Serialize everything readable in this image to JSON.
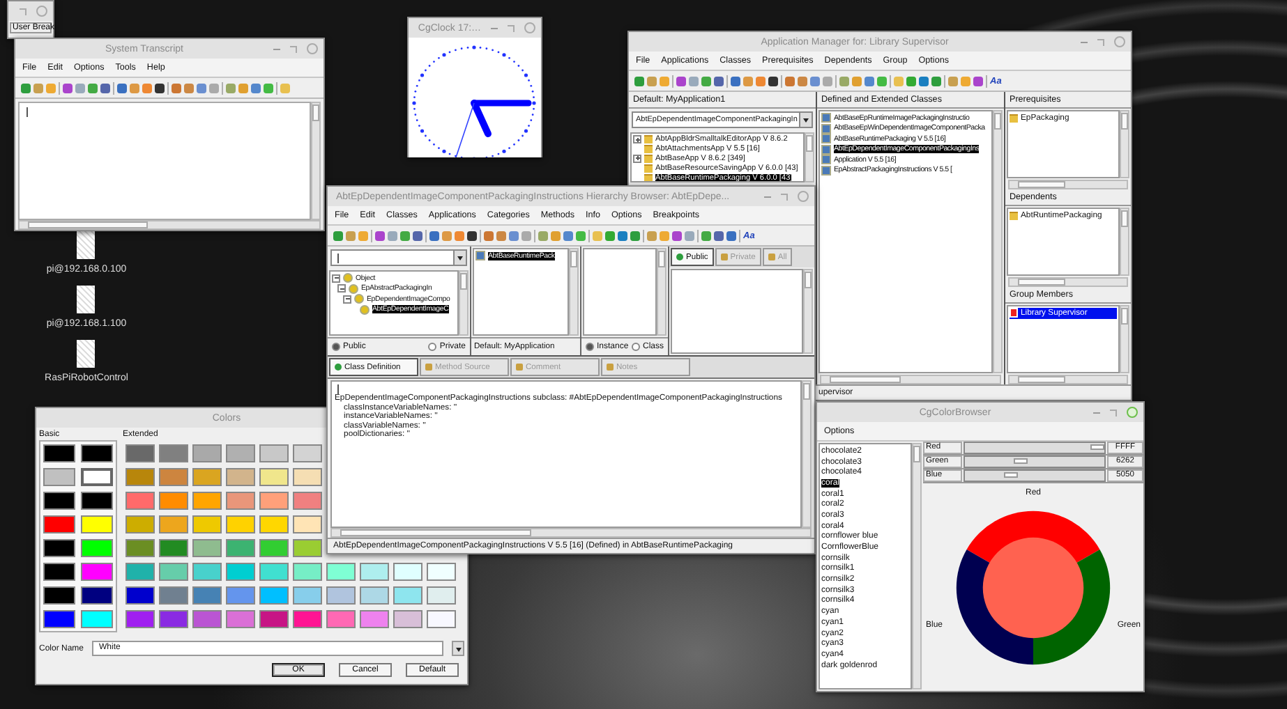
{
  "user_break": {
    "button": "User Break"
  },
  "desktop_icons": [
    {
      "label": "pi@192.168.0.100"
    },
    {
      "label": "pi@192.168.1.100"
    },
    {
      "label": "RasPiRobotControl"
    }
  ],
  "transcript": {
    "title": "System Transcript",
    "menu": [
      "File",
      "Edit",
      "Options",
      "Tools",
      "Help"
    ]
  },
  "clock": {
    "title": "CgClock 17:…"
  },
  "app_manager": {
    "title": "Application Manager for: Library Supervisor",
    "menu": [
      "File",
      "Applications",
      "Classes",
      "Prerequisites",
      "Dependents",
      "Group",
      "Options"
    ],
    "font_button": "Aa",
    "default_label": "Default: MyApplication1",
    "application_field": "AbtEpDependentImageComponentPackagingIn",
    "applications": [
      {
        "label": "AbtAppBldrSmalltalkEditorApp V 8.6.2",
        "expandable": true,
        "selected": false
      },
      {
        "label": "AbtAttachmentsApp V 5.5  [16]",
        "expandable": false,
        "selected": false
      },
      {
        "label": "AbtBaseApp V 8.6.2  [349]",
        "expandable": true,
        "selected": false
      },
      {
        "label": "AbtBaseResourceSavingApp V 6.0.0  [43]",
        "expandable": false,
        "selected": false
      },
      {
        "label": "AbtBaseRuntimePackaging V 6.0.0  [43]",
        "expandable": false,
        "selected": true
      }
    ],
    "classes_header": "Defined and Extended Classes",
    "classes": [
      {
        "label": "AbtBaseEpRuntimeImagePackagingInstructio",
        "selected": false
      },
      {
        "label": "AbtBaseEpWinDependentImageComponentPacka",
        "selected": false
      },
      {
        "label": "AbtBaseRuntimePackaging V 5.5  [16]",
        "selected": false
      },
      {
        "label": "AbtEpDependentImageComponentPackagingIns",
        "selected": true
      },
      {
        "label": "Application V 5.5  [16]",
        "selected": false
      },
      {
        "label": "EpAbstractPackagingInstructions V 5.5  [",
        "selected": false
      }
    ],
    "prerequisites_header": "Prerequisites",
    "prerequisites": [
      "EpPackaging"
    ],
    "dependents_header": "Dependents",
    "dependents": [
      "AbtRuntimePackaging"
    ],
    "group_header": "Group Members",
    "group_members": [
      {
        "label": "Library Supervisor",
        "selected": true
      }
    ],
    "status": "upervisor"
  },
  "hierarchy": {
    "title": "AbtEpDependentImageComponentPackagingInstructions Hierarchy Browser: AbtEpDepe...",
    "menu": [
      "File",
      "Edit",
      "Classes",
      "Applications",
      "Categories",
      "Methods",
      "Info",
      "Options",
      "Breakpoints"
    ],
    "font_button": "Aa",
    "class_tree": [
      {
        "label": "Object",
        "selected": false,
        "children": [
          {
            "label": "EpAbstractPackagingIn",
            "selected": false,
            "children": [
              {
                "label": "EpDependentImageCompo",
                "selected": false,
                "children": [
                  {
                    "label": "AbtEpDependentImageC",
                    "selected": true
                  }
                ]
              }
            ]
          }
        ]
      }
    ],
    "applications": [
      {
        "label": "AbtBaseRuntimePack",
        "selected": true
      }
    ],
    "visibility_radios": [
      {
        "label": "Public",
        "selected": true
      },
      {
        "label": "Private",
        "selected": false
      }
    ],
    "default_label": "Default: MyApplication",
    "side_radios": [
      {
        "label": "Instance",
        "selected": true
      },
      {
        "label": "Class",
        "selected": false
      }
    ],
    "method_tabs": [
      {
        "label": "Public",
        "selected": true
      },
      {
        "label": "Private",
        "selected": false
      },
      {
        "label": "All",
        "selected": false
      }
    ],
    "editor_tabs": [
      {
        "label": "Class Definition",
        "selected": true
      },
      {
        "label": "Method Source",
        "selected": false
      },
      {
        "label": "Comment",
        "selected": false
      },
      {
        "label": "Notes",
        "selected": false
      }
    ],
    "code": [
      "EpDependentImageComponentPackagingInstructions subclass: #AbtEpDependentImageComponentPackagingInstructions",
      "    classInstanceVariableNames: ''",
      "    instanceVariableNames: ''",
      "    classVariableNames: ''",
      "    poolDictionaries: ''"
    ],
    "status": "AbtEpDependentImageComponentPackagingInstructions V 5.5  [16] (Defined) in AbtBaseRuntimePackaging"
  },
  "colors": {
    "title": "Colors",
    "basic_label": "Basic",
    "extended_label": "Extended",
    "basic": [
      {
        "color": "#000000",
        "selected": false
      },
      {
        "color": "#000000",
        "selected": false
      },
      {
        "color": "#c0c0c0",
        "selected": false
      },
      {
        "color": "#ffffff",
        "selected": true
      },
      {
        "color": "#000000",
        "selected": false
      },
      {
        "color": "#000000",
        "selected": false
      },
      {
        "color": "#ff0000",
        "selected": false
      },
      {
        "color": "#ffff00",
        "selected": false
      },
      {
        "color": "#000000",
        "selected": false
      },
      {
        "color": "#00ff00",
        "selected": false
      },
      {
        "color": "#000000",
        "selected": false
      },
      {
        "color": "#ff00ff",
        "selected": false
      },
      {
        "color": "#000000",
        "selected": false
      },
      {
        "color": "#000080",
        "selected": false
      },
      {
        "color": "#0000ff",
        "selected": false
      },
      {
        "color": "#00ffff",
        "selected": false
      }
    ],
    "extended": [
      {
        "swatches": [
          {
            "color": "#696969"
          },
          {
            "color": "#808080"
          },
          {
            "color": "#a9a9a9"
          },
          {
            "color": "#b0b0b0"
          },
          {
            "color": "#c8c8c8"
          },
          {
            "color": "#d3d3d3"
          }
        ]
      },
      {
        "swatches": [
          {
            "color": "#b8860b"
          },
          {
            "color": "#cd853f"
          },
          {
            "color": "#daa520"
          },
          {
            "color": "#d2b48c"
          },
          {
            "color": "#f0e68c"
          },
          {
            "color": "#f5deb3"
          }
        ]
      },
      {
        "swatches": [
          {
            "color": "#ff6a6a"
          },
          {
            "color": "#ff8c00"
          },
          {
            "color": "#ffa500"
          },
          {
            "color": "#e9967a"
          },
          {
            "color": "#ffa07a"
          },
          {
            "color": "#f08080"
          }
        ]
      },
      {
        "swatches": [
          {
            "color": "#cdad00"
          },
          {
            "color": "#eda61d"
          },
          {
            "color": "#eec900"
          },
          {
            "color": "#ffd200"
          },
          {
            "color": "#ffd700"
          },
          {
            "color": "#ffe4b5"
          }
        ]
      },
      {
        "swatches": [
          {
            "color": "#6b8e23"
          },
          {
            "color": "#228b22"
          },
          {
            "color": "#8fbc8f"
          },
          {
            "color": "#3cb371"
          },
          {
            "color": "#32cd32"
          },
          {
            "color": "#9acd32"
          }
        ]
      },
      {
        "swatches": [
          {
            "color": "#20b2aa"
          },
          {
            "color": "#66cdaa"
          },
          {
            "color": "#48d1cc"
          },
          {
            "color": "#00ced1"
          },
          {
            "color": "#40e0d0"
          },
          {
            "color": "#76eec6"
          },
          {
            "color": "#7fffd4"
          },
          {
            "color": "#aeeeee"
          },
          {
            "color": "#e0ffff"
          },
          {
            "color": "#f0ffff"
          }
        ]
      },
      {
        "swatches": [
          {
            "color": "#0000cd"
          },
          {
            "color": "#708090"
          },
          {
            "color": "#4682b4"
          },
          {
            "color": "#6495ed"
          },
          {
            "color": "#00bfff"
          },
          {
            "color": "#87ceeb"
          },
          {
            "color": "#b0c4de"
          },
          {
            "color": "#add8e6"
          },
          {
            "color": "#8ee5ee"
          },
          {
            "color": "#e0eeee"
          }
        ]
      },
      {
        "swatches": [
          {
            "color": "#a020f0"
          },
          {
            "color": "#8a2be2"
          },
          {
            "color": "#ba55d3"
          },
          {
            "color": "#da70d6"
          },
          {
            "color": "#c71585"
          },
          {
            "color": "#ff1493"
          },
          {
            "color": "#ff69b4"
          },
          {
            "color": "#ee82ee"
          },
          {
            "color": "#d8bfd8"
          },
          {
            "color": "#f8f8ff"
          }
        ]
      }
    ],
    "color_name_label": "Color Name",
    "color_name": "White",
    "buttons": [
      {
        "label": "OK",
        "default": true
      },
      {
        "label": "Cancel",
        "default": false
      },
      {
        "label": "Default",
        "default": false
      }
    ]
  },
  "color_browser": {
    "title": "CgColorBrowser",
    "menu": [
      "Options"
    ],
    "colors": [
      {
        "label": "chocolate2",
        "selected": false
      },
      {
        "label": "chocolate3",
        "selected": false
      },
      {
        "label": "chocolate4",
        "selected": false
      },
      {
        "label": "coral",
        "selected": true
      },
      {
        "label": "coral1",
        "selected": false
      },
      {
        "label": "coral2",
        "selected": false
      },
      {
        "label": "coral3",
        "selected": false
      },
      {
        "label": "coral4",
        "selected": false
      },
      {
        "label": "cornflower blue",
        "selected": false
      },
      {
        "label": "CornflowerBlue",
        "selected": false
      },
      {
        "label": "cornsilk",
        "selected": false
      },
      {
        "label": "cornsilk1",
        "selected": false
      },
      {
        "label": "cornsilk2",
        "selected": false
      },
      {
        "label": "cornsilk3",
        "selected": false
      },
      {
        "label": "cornsilk4",
        "selected": false
      },
      {
        "label": "cyan",
        "selected": false
      },
      {
        "label": "cyan1",
        "selected": false
      },
      {
        "label": "cyan2",
        "selected": false
      },
      {
        "label": "cyan3",
        "selected": false
      },
      {
        "label": "cyan4",
        "selected": false
      },
      {
        "label": "dark goldenrod",
        "selected": false
      }
    ],
    "channels": [
      {
        "name": "Red",
        "level": 0.95,
        "reading": "FFFF"
      },
      {
        "name": "Green",
        "level": 0.4,
        "reading": "6262"
      },
      {
        "name": "Blue",
        "level": 0.33,
        "reading": "5050"
      }
    ],
    "wheel_labels": [
      "Red",
      "Green",
      "Blue"
    ]
  }
}
